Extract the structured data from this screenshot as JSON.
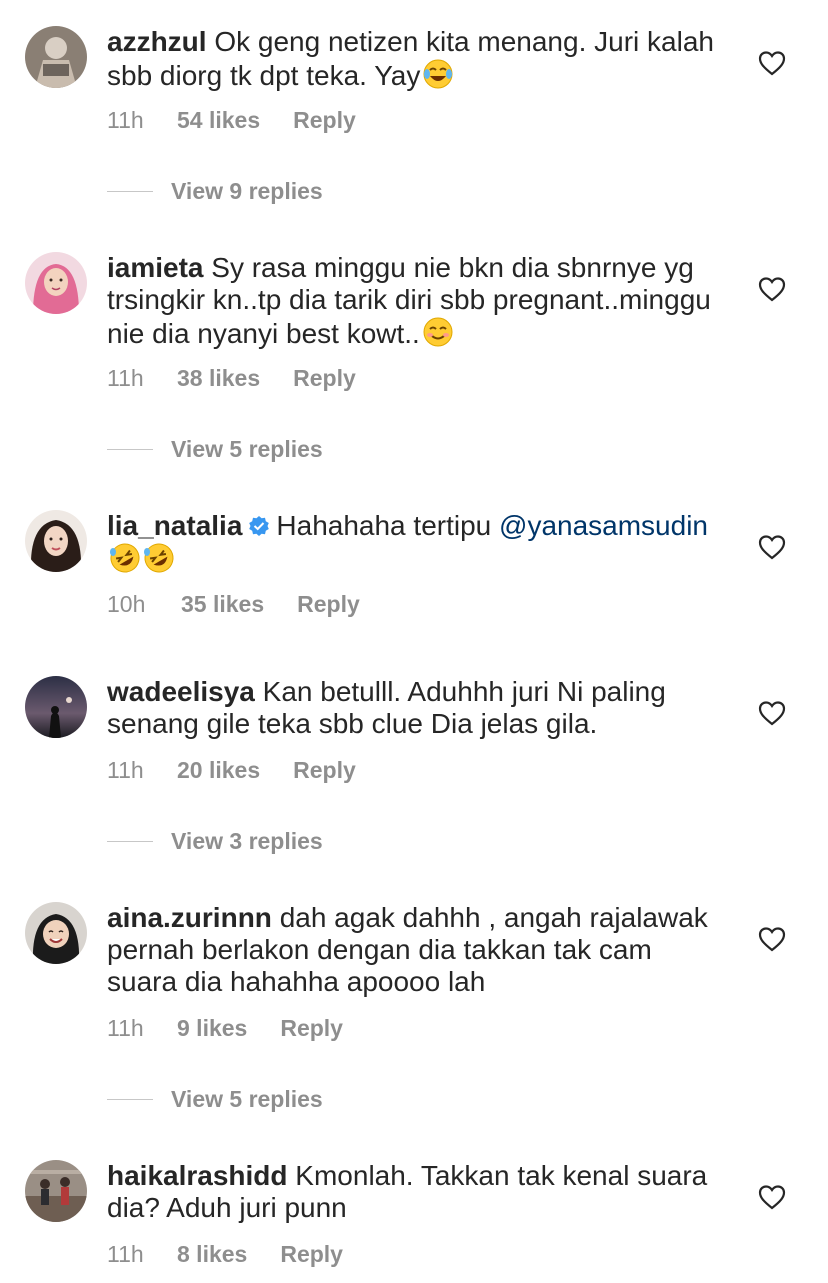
{
  "comments": [
    {
      "username": "azzhzul",
      "text": "Ok geng netizen kita menang. Juri kalah sbb diorg tk dpt teka. Yay",
      "emoji": "tears-of-joy",
      "time": "11h",
      "likes": "54 likes",
      "reply": "Reply",
      "view_replies": "View 9 replies"
    },
    {
      "username": "iamieta",
      "text": "Sy rasa minggu nie bkn dia sbnrnye yg trsingkir kn..tp dia tarik diri sbb pregnant..minggu nie dia nyanyi best kowt..",
      "emoji": "smiling-face",
      "time": "11h",
      "likes": "38 likes",
      "reply": "Reply",
      "view_replies": "View 5 replies"
    },
    {
      "username": "lia_natalia",
      "verified": true,
      "text": "Hahahaha tertipu",
      "mention": "@yanasamsudin",
      "emoji": "rolling-on-floor-laughing x2",
      "time": "10h",
      "likes": "35 likes",
      "reply": "Reply"
    },
    {
      "username": "wadeelisya",
      "text": "Kan betulll. Aduhhh juri Ni paling senang gile teka sbb clue Dia jelas gila.",
      "time": "11h",
      "likes": "20 likes",
      "reply": "Reply",
      "view_replies": "View 3 replies"
    },
    {
      "username": "aina.zurinnn",
      "text": "dah agak dahhh , angah rajalawak pernah berlakon dengan dia takkan tak cam suara dia hahahha apoooo lah",
      "time": "11h",
      "likes": "9 likes",
      "reply": "Reply",
      "view_replies": "View 5 replies"
    },
    {
      "username": "haikalrashidd",
      "text": "Kmonlah. Takkan tak kenal suara dia? Aduh juri punn",
      "time": "11h",
      "likes": "8 likes",
      "reply": "Reply"
    }
  ],
  "colors": {
    "text": "#262626",
    "meta": "#8e8e8e",
    "mention": "#003569",
    "verified": "#3897f0"
  },
  "icons": {
    "like": "heart-outline-icon",
    "verified": "verified-badge-icon"
  }
}
